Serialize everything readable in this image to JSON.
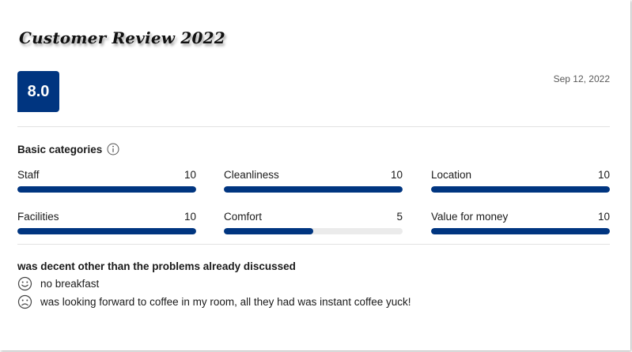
{
  "title": "Customer Review 2022",
  "score": "8.0",
  "review_date": "Sep 12, 2022",
  "section_heading": "Basic categories",
  "categories": [
    {
      "label": "Staff",
      "score": "10",
      "fraction": 1.0
    },
    {
      "label": "Cleanliness",
      "score": "10",
      "fraction": 1.0
    },
    {
      "label": "Location",
      "score": "10",
      "fraction": 1.0
    },
    {
      "label": "Facilities",
      "score": "10",
      "fraction": 1.0
    },
    {
      "label": "Comfort",
      "score": "5",
      "fraction": 0.5
    },
    {
      "label": "Value for money",
      "score": "10",
      "fraction": 1.0
    }
  ],
  "review_title": "was decent other than the problems already discussed",
  "positive_comment": "no breakfast",
  "negative_comment": "was looking forward to coffee in my room, all they had was instant coffee yuck!",
  "colors": {
    "brand": "#003580",
    "track": "#ebebeb"
  },
  "icons": {
    "info": "info-icon",
    "positive": "smile-icon",
    "negative": "frown-icon"
  }
}
